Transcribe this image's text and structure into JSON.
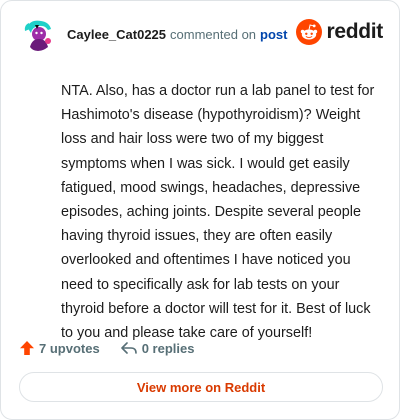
{
  "comment": {
    "username": "Caylee_Cat0225",
    "action_text": "commented on",
    "post_link": "post",
    "body": "NTA. Also, has a doctor run a lab panel to test for Hashimoto's disease (hypothyroidism)? Weight loss and hair loss were two of my biggest symptoms when I was sick. I would get easily fatigued, mood swings, headaches, depressive episodes, aching joints. Despite several people having thyroid issues, they are often easily overlooked and oftentimes I have noticed you need to specifically ask for lab tests on your thyroid before a doctor will test for it. Best of luck to you and please take care of yourself!"
  },
  "brand": {
    "name": "reddit",
    "color": "#ff4500",
    "icon": "reddit-snoo-icon"
  },
  "actions": {
    "upvotes": "7 upvotes",
    "upvote_icon": "upvote-arrow-icon",
    "upvote_color": "#ff4500",
    "replies": "0 replies",
    "reply_icon": "reply-arrow-icon"
  },
  "footer": {
    "view_more_label": "View more on Reddit",
    "accent_color": "#d93a00"
  }
}
